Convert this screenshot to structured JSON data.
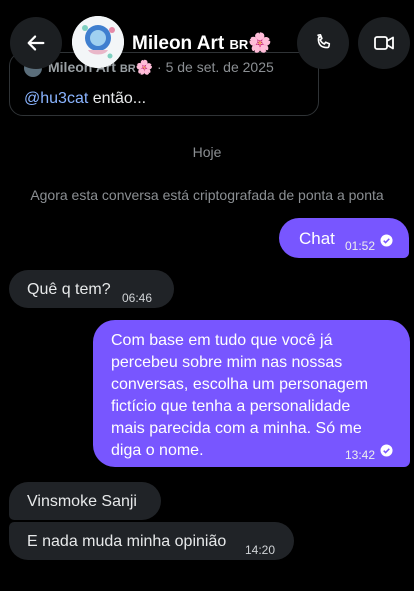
{
  "header": {
    "contact_name": "Mileon Art",
    "contact_badge": "BR",
    "contact_emoji": "🌸"
  },
  "quoted": {
    "author": "Mileon Art",
    "badge": "BR",
    "emoji": "🌸",
    "date": "· 5 de set. de 2025",
    "mention": "@hu3cat",
    "text": " então..."
  },
  "thread": {
    "date_separator": "Hoje",
    "encryption_note": "Agora esta conversa está criptografada de ponta a ponta"
  },
  "messages": [
    {
      "direction": "out",
      "text": "Chat",
      "time": "01:52",
      "status": "read"
    },
    {
      "direction": "in",
      "text": "Quê q tem?",
      "time": "06:46"
    },
    {
      "direction": "out",
      "text": "Com base em tudo que você já percebeu sobre mim nas nossas conversas, escolha um personagem fictício que tenha a personalidade mais parecida com a minha. Só me diga o nome.",
      "time": "13:42",
      "status": "read"
    },
    {
      "direction": "in",
      "text": "Vinsmoke Sanji",
      "time": ""
    },
    {
      "direction": "in",
      "text": "E nada muda minha opinião",
      "time": "14:20"
    }
  ],
  "icons": {
    "back": "arrow-left-icon",
    "call": "phone-icon",
    "video": "video-camera-icon",
    "read": "check-circle-icon"
  },
  "colors": {
    "background": "#000000",
    "outgoing_bubble": "#7856ff",
    "incoming_bubble": "#202327",
    "mention": "#8ab4ff"
  }
}
